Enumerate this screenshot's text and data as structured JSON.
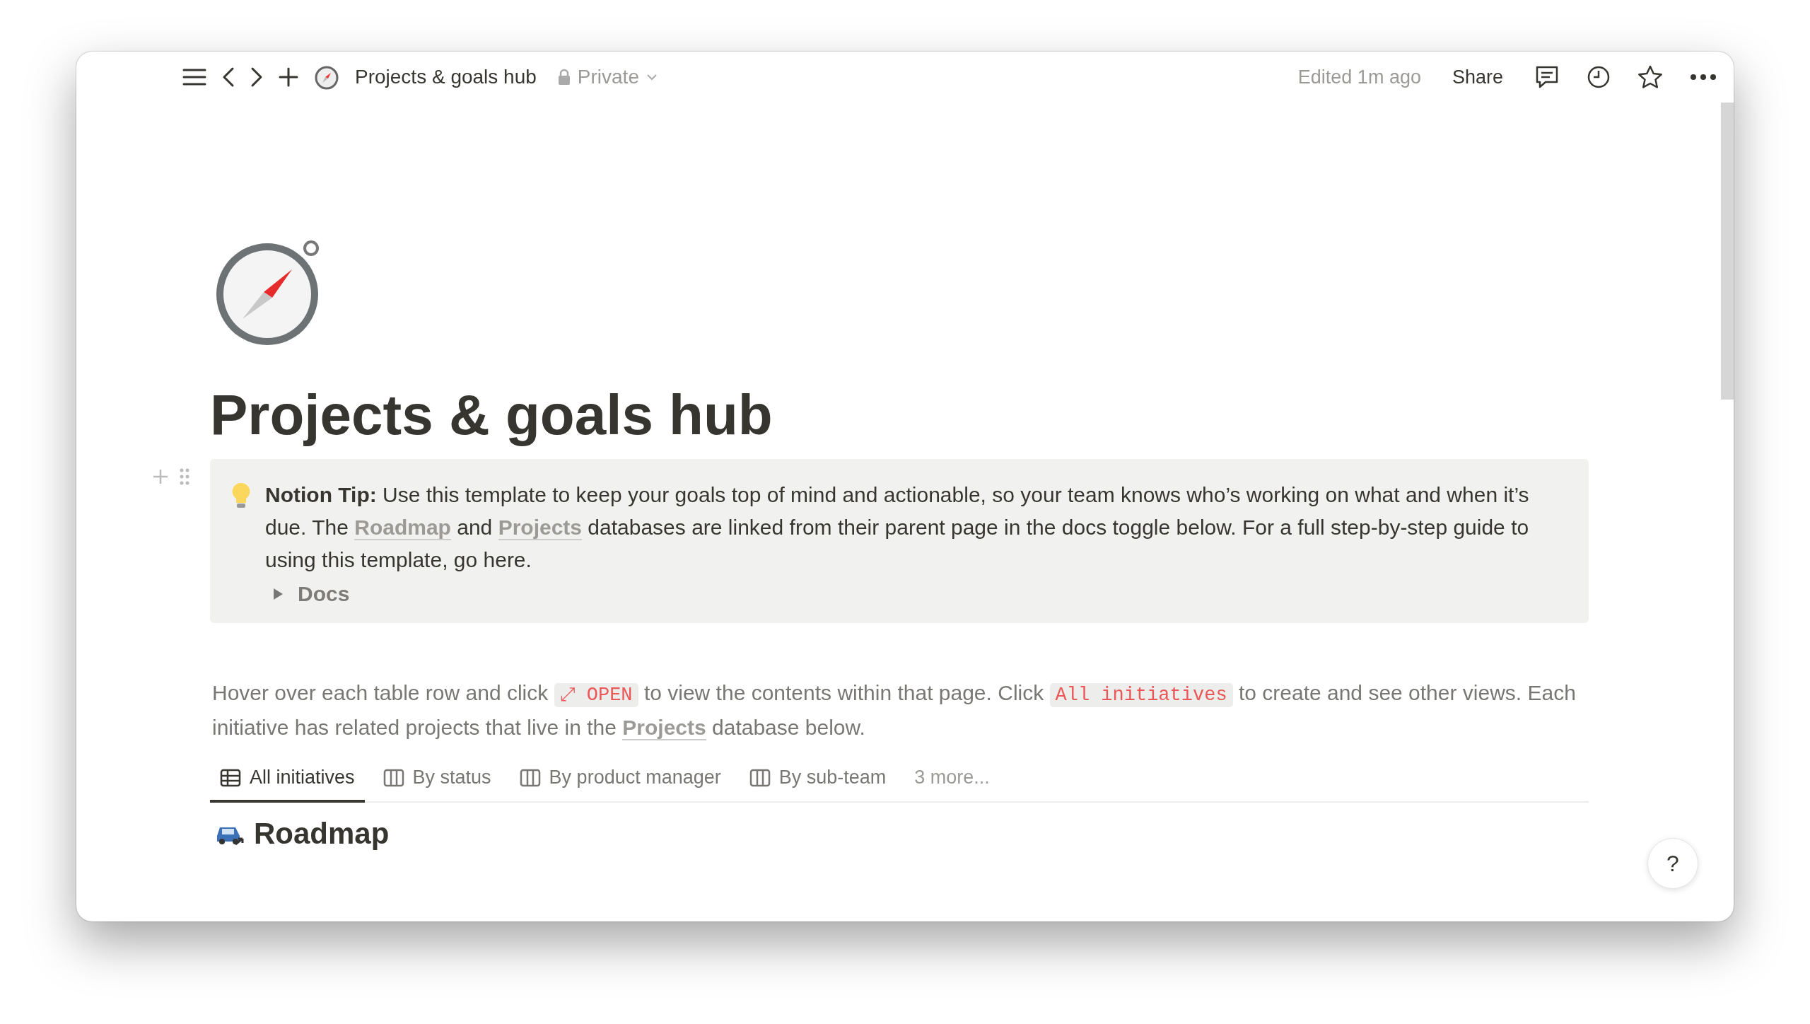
{
  "topbar": {
    "page_title": "Projects & goals hub",
    "privacy": "Private",
    "edited": "Edited 1m ago",
    "share": "Share"
  },
  "page": {
    "title": "Projects & goals hub"
  },
  "callout": {
    "parts": [
      {
        "kind": "bold",
        "text": "Notion Tip:"
      },
      {
        "kind": "text",
        "text": " Use this template to keep your goals top of mind and actionable, so your team knows who’s working on what and when it’s due. The "
      },
      {
        "kind": "link",
        "text": "Roadmap"
      },
      {
        "kind": "text",
        "text": " and "
      },
      {
        "kind": "link",
        "text": "Projects"
      },
      {
        "kind": "text",
        "text": " databases are linked from their parent page in the docs toggle below. For a full step-by-step guide to using this template, go here."
      }
    ],
    "toggle": {
      "label": "Docs",
      "expanded": false
    }
  },
  "intro": {
    "parts": [
      {
        "kind": "text",
        "text": "Hover over each table row and click "
      },
      {
        "kind": "code",
        "text": "⤢ OPEN"
      },
      {
        "kind": "text",
        "text": " to view the contents within that page. Click "
      },
      {
        "kind": "code",
        "text": "All initiatives"
      },
      {
        "kind": "text",
        "text": " to create and see other views. Each initiative has related projects that live in the "
      },
      {
        "kind": "link",
        "text": "Projects"
      },
      {
        "kind": "text",
        "text": " database below."
      }
    ]
  },
  "tabs": [
    {
      "label": "All initiatives",
      "kind": "table",
      "selected": true
    },
    {
      "label": "By status",
      "kind": "board",
      "selected": false
    },
    {
      "label": "By product manager",
      "kind": "board",
      "selected": false
    },
    {
      "label": "By sub-team",
      "kind": "board",
      "selected": false
    }
  ],
  "more_views": "3 more...",
  "database": {
    "title": "Roadmap"
  },
  "help": "?"
}
